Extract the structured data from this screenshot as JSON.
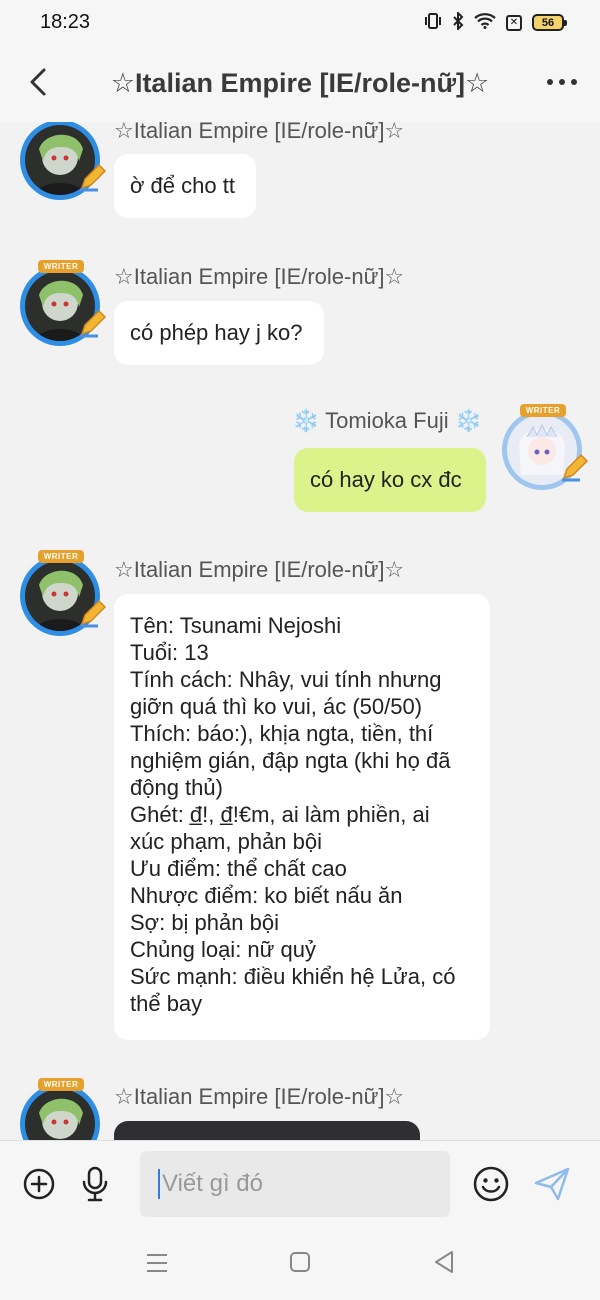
{
  "status_bar": {
    "time": "18:23",
    "battery": "56"
  },
  "header": {
    "title": "☆Italian Empire [IE/role-nữ]☆"
  },
  "avatars": {
    "badge": "WRITER"
  },
  "messages": [
    {
      "sender": "☆Italian Empire [IE/role-nữ]☆",
      "text": "ờ để cho tt"
    },
    {
      "sender": "☆Italian Empire [IE/role-nữ]☆",
      "text": "có phép hay j ko?"
    },
    {
      "sender": "Tomioka Fuji",
      "sender_deco": "❄️",
      "text": "có hay ko cx đc"
    },
    {
      "sender": "☆Italian Empire [IE/role-nữ]☆",
      "lines": [
        "Tên: Tsunami Nejoshi",
        "Tuổi: 13",
        "Tính cách: Nhây, vui tính nhưng",
        "giỡn quá thì ko vui, ác (50/50)",
        "Thích: báo:), khịa ngta, tiền, thí",
        "nghiệm gián, đập ngta (khi họ đã",
        "động thủ)",
        "Ghét: đ̲!, đ̲!€m, ai làm phiền, ai",
        "xúc phạm, phản bội",
        "Ưu điểm: thể chất cao",
        "Nhược điểm: ko biết nấu ăn",
        "Sợ: bị phản bội",
        "Chủng loại: nữ quỷ",
        "Sức mạnh: điều khiển hệ Lửa, có",
        "thể bay"
      ]
    },
    {
      "sender": "☆Italian Empire [IE/role-nữ]☆"
    }
  ],
  "composer": {
    "placeholder": "Viết gì đó"
  },
  "colors": {
    "my_bubble": "#dcf38c",
    "their_bubble": "#ffffff",
    "avatar_ring": "#2e8ee6",
    "send_accent": "#6fa8e6"
  }
}
